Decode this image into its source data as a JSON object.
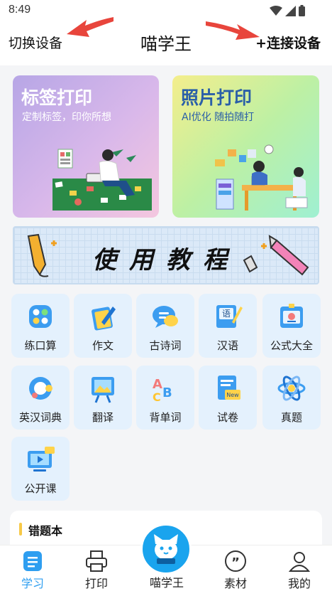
{
  "status": {
    "time": "8:49"
  },
  "header": {
    "left": "切换设备",
    "title": "喵学王",
    "right": "+连接设备"
  },
  "cards": [
    {
      "title": "标签打印",
      "subtitle": "定制标签，印你所想"
    },
    {
      "title": "照片打印",
      "subtitle": "AI优化 随拍随打"
    }
  ],
  "tutorial": {
    "text": "使用教程"
  },
  "tools": [
    {
      "label": "练口算",
      "icon": "calculator-icon"
    },
    {
      "label": "作文",
      "icon": "pen-notebook-icon"
    },
    {
      "label": "古诗词",
      "icon": "chat-bubble-icon"
    },
    {
      "label": "汉语",
      "icon": "chinese-book-icon"
    },
    {
      "label": "公式大全",
      "icon": "formula-card-icon"
    },
    {
      "label": "英汉词典",
      "icon": "dictionary-icon"
    },
    {
      "label": "翻译",
      "icon": "easel-icon"
    },
    {
      "label": "背单词",
      "icon": "abc-letters-icon"
    },
    {
      "label": "试卷",
      "icon": "exam-paper-icon"
    },
    {
      "label": "真题",
      "icon": "atom-icon"
    },
    {
      "label": "公开课",
      "icon": "video-lesson-icon"
    }
  ],
  "wrong_book": {
    "title": "错题本"
  },
  "tabs": [
    {
      "label": "学习",
      "active": true
    },
    {
      "label": "打印"
    },
    {
      "label": "喵学王"
    },
    {
      "label": "素材"
    },
    {
      "label": "我的"
    }
  ],
  "colors": {
    "accent": "#2e9ef0",
    "tile_bg": "#e4f1fd",
    "arrow": "#e8453c"
  }
}
